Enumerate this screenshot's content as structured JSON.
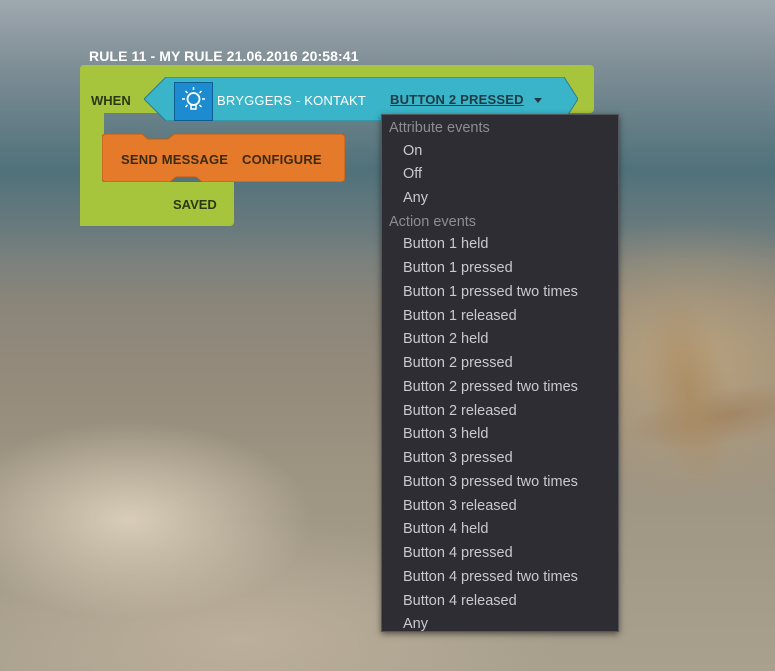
{
  "rule": {
    "title": "RULE 11 - MY RULE 21.06.2016 20:58:41",
    "when_label": "WHEN",
    "saved_label": "SAVED"
  },
  "trigger": {
    "device_icon": "lightbulb-icon",
    "device_name": "BRYGGERS - KONTAKT",
    "selected_event": "BUTTON 2 PRESSED",
    "block_color": "#3ab4c8"
  },
  "action": {
    "label": "SEND MESSAGE",
    "configure_label": "CONFIGURE",
    "block_color": "#e57a2a"
  },
  "colors": {
    "rule_block": "#a7c43d",
    "dropdown_bg": "#2d2d33"
  },
  "dropdown": {
    "group_attribute": "Attribute events",
    "attribute_options": [
      "On",
      "Off",
      "Any"
    ],
    "group_action": "Action events",
    "action_options": [
      "Button 1 held",
      "Button 1 pressed",
      "Button 1 pressed two times",
      "Button 1 released",
      "Button 2 held",
      "Button 2 pressed",
      "Button 2 pressed two times",
      "Button 2 released",
      "Button 3 held",
      "Button 3 pressed",
      "Button 3 pressed two times",
      "Button 3 released",
      "Button 4 held",
      "Button 4 pressed",
      "Button 4 pressed two times",
      "Button 4 released",
      "Any"
    ]
  }
}
